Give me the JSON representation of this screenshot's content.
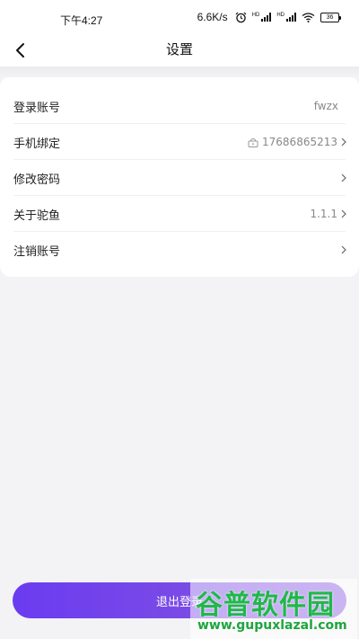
{
  "status_bar": {
    "time": "下午4:27",
    "speed": "6.6K/s",
    "sim1_label": "HD",
    "sim2_label": "HD",
    "battery": "36"
  },
  "header": {
    "title": "设置"
  },
  "settings": [
    {
      "label": "登录账号",
      "value": "fwzx",
      "arrow": false
    },
    {
      "label": "手机绑定",
      "value": "17686865213",
      "arrow": true,
      "lock_icon": true
    },
    {
      "label": "修改密码",
      "value": "",
      "arrow": true
    },
    {
      "label": "关于驼鱼",
      "value": "1.1.1",
      "arrow": true
    },
    {
      "label": "注销账号",
      "value": "",
      "arrow": true
    }
  ],
  "logout_label": "退出登录",
  "watermark": {
    "logo": "谷普软件园",
    "url": "www.gupuxlazal.com"
  },
  "colors": {
    "accent_start": "#6a3cf0",
    "accent_end": "#8b5ae0",
    "background": "#f3f3f5"
  }
}
